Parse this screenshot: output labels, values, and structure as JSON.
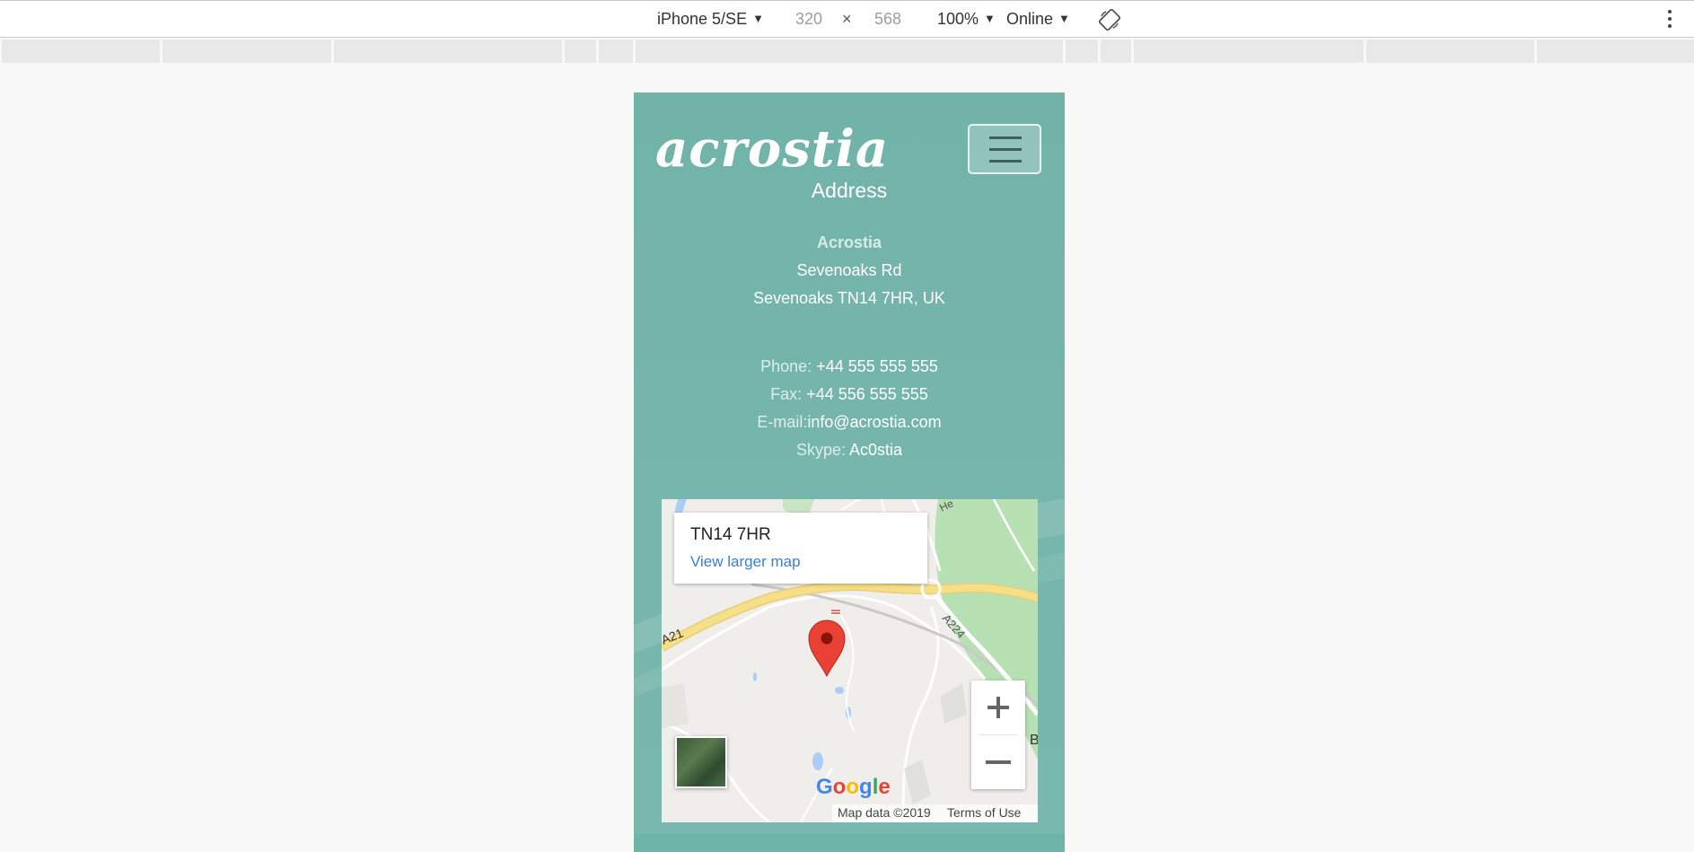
{
  "toolbar": {
    "device": "iPhone 5/SE",
    "width": "320",
    "times": "×",
    "height": "568",
    "zoom": "100%",
    "network": "Online",
    "caret": "▼"
  },
  "site": {
    "logo": "acrostia",
    "section_title": "Address",
    "company": "Acrostia",
    "street": "Sevenoaks Rd",
    "city": "Sevenoaks TN14 7HR, UK",
    "phone_label": "Phone:",
    "phone": "+44 555 555 555",
    "fax_label": "Fax:",
    "fax": "+44 556 555 555",
    "email_label": "E-mail:",
    "email": "info@acrostia.com",
    "skype_label": "Skype:",
    "skype": "Ac0stia"
  },
  "map": {
    "place": "TN14 7HR",
    "larger_map": "View larger map",
    "road1": "A224",
    "road2": "A21",
    "road3": "He",
    "edge_label": "B",
    "attribution": "Map data ©2019",
    "terms": "Terms of Use",
    "google": [
      "G",
      "o",
      "o",
      "g",
      "l",
      "e"
    ],
    "colors": {
      "roads_major": "#f7df88",
      "park": "#b7e0b3",
      "water": "#a9cdf5",
      "marker": "#e94235"
    }
  }
}
